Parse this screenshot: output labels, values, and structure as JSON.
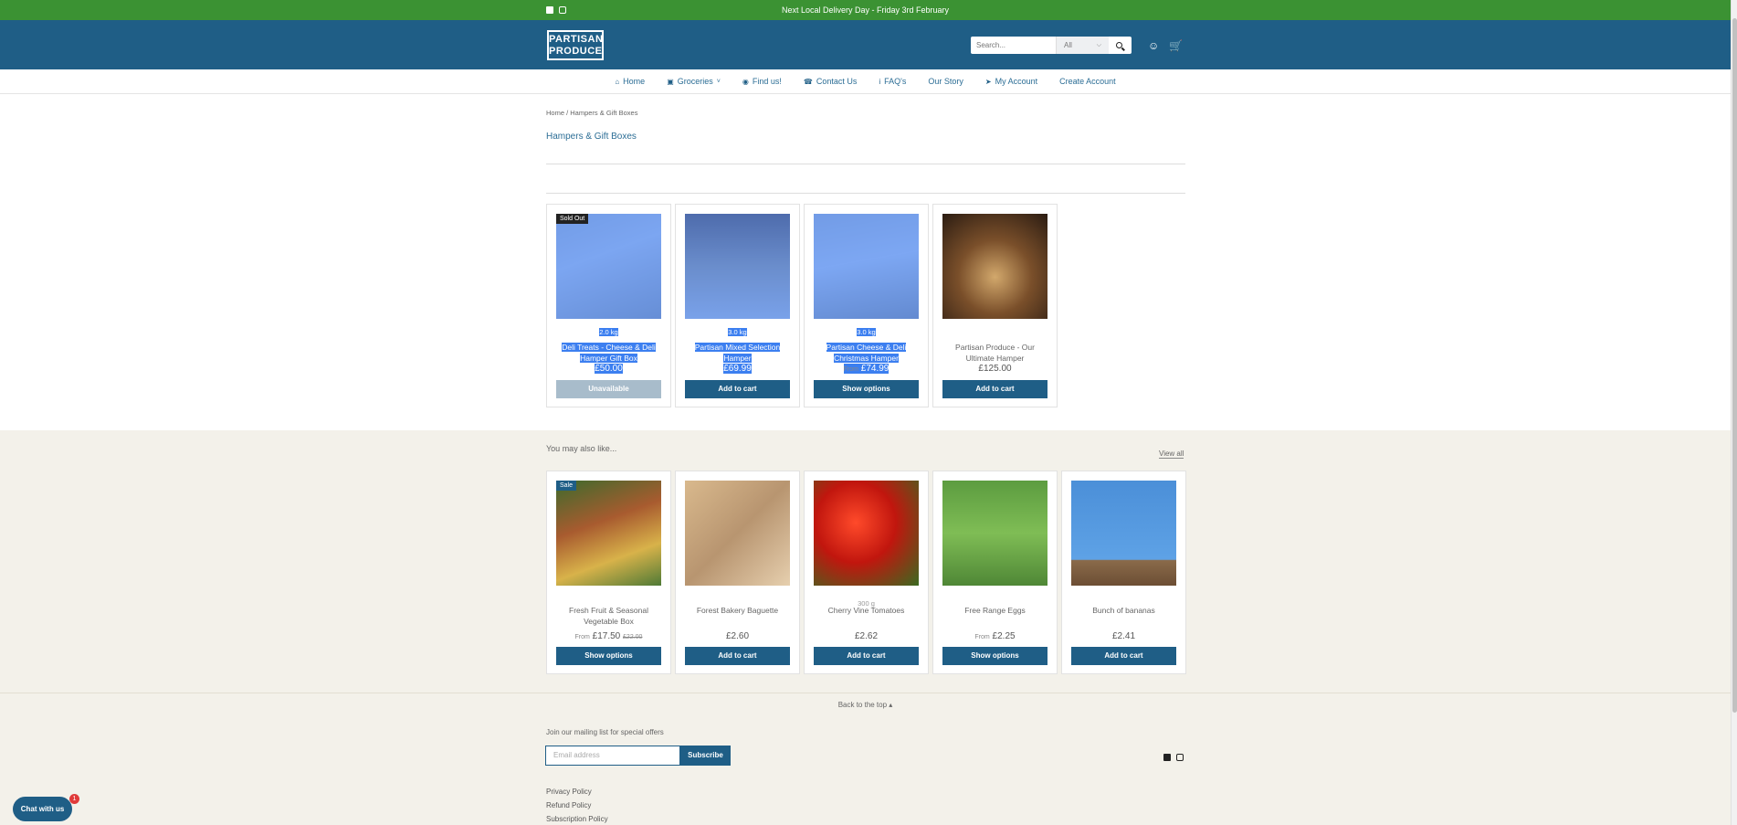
{
  "announcement": "Next Local Delivery Day - Friday 3rd February",
  "logo_text": "PARTISAN PRODUCE",
  "search": {
    "placeholder": "Search...",
    "category": "All"
  },
  "nav": [
    {
      "label": "Home",
      "icon": "home-icon"
    },
    {
      "label": "Groceries",
      "icon": "basket-icon"
    },
    {
      "label": "Find us!",
      "icon": "map-pin-icon"
    },
    {
      "label": "Contact Us",
      "icon": "phone-icon"
    },
    {
      "label": "FAQ's",
      "icon": "info-icon"
    },
    {
      "label": "Our Story",
      "icon": ""
    },
    {
      "label": "My Account",
      "icon": "rocket-icon"
    },
    {
      "label": "Create Account",
      "icon": ""
    }
  ],
  "breadcrumb": "Home / Hampers & Gift Boxes",
  "page_title": "Hampers & Gift Boxes",
  "products": [
    {
      "badge": "Sold Out",
      "weight": "2.0 kg",
      "name": "Deli Treats - Cheese & Deli Hamper Gift Box",
      "price_prefix": "",
      "price": "£50.00",
      "button": "Unavailable",
      "selected": true
    },
    {
      "badge": "",
      "weight": "3.0 kg",
      "name": "Partisan Mixed Selection Hamper",
      "price_prefix": "",
      "price": "£69.99",
      "button": "Add to cart",
      "selected": true
    },
    {
      "badge": "",
      "weight": "3.0 kg",
      "name": "Partisan Cheese & Deli Christmas Hamper",
      "price_prefix": "From",
      "price": "£74.99",
      "button": "Show options",
      "selected": true
    },
    {
      "badge": "",
      "weight": "",
      "name": "Partisan Produce - Our Ultimate Hamper",
      "price_prefix": "",
      "price": "£125.00",
      "button": "Add to cart",
      "selected": false
    }
  ],
  "also_title": "You may also like...",
  "view_all": "View all",
  "related": [
    {
      "badge": "Sale",
      "weight": "",
      "name": "Fresh Fruit & Seasonal Vegetable Box",
      "price_prefix": "From",
      "price": "£17.50",
      "compare": "£22.00",
      "button": "Show options"
    },
    {
      "badge": "",
      "weight": "",
      "name": "Forest Bakery Baguette",
      "price_prefix": "",
      "price": "£2.60",
      "compare": "",
      "button": "Add to cart"
    },
    {
      "badge": "",
      "weight": "300 g",
      "name": "Cherry Vine Tomatoes",
      "price_prefix": "",
      "price": "£2.62",
      "compare": "",
      "button": "Add to cart"
    },
    {
      "badge": "",
      "weight": "",
      "name": "Free Range Eggs",
      "price_prefix": "From",
      "price": "£2.25",
      "compare": "",
      "button": "Show options"
    },
    {
      "badge": "",
      "weight": "",
      "name": "Bunch of bananas",
      "price_prefix": "",
      "price": "£2.41",
      "compare": "",
      "button": "Add to cart"
    }
  ],
  "back_to_top": "Back to the top ▴",
  "mailing": "Join our mailing list for special offers",
  "email_placeholder": "Email address",
  "subscribe": "Subscribe",
  "footer_links": [
    "Privacy Policy",
    "Refund Policy",
    "Subscription Policy"
  ],
  "chat": {
    "label": "Chat with us",
    "count": "1"
  }
}
